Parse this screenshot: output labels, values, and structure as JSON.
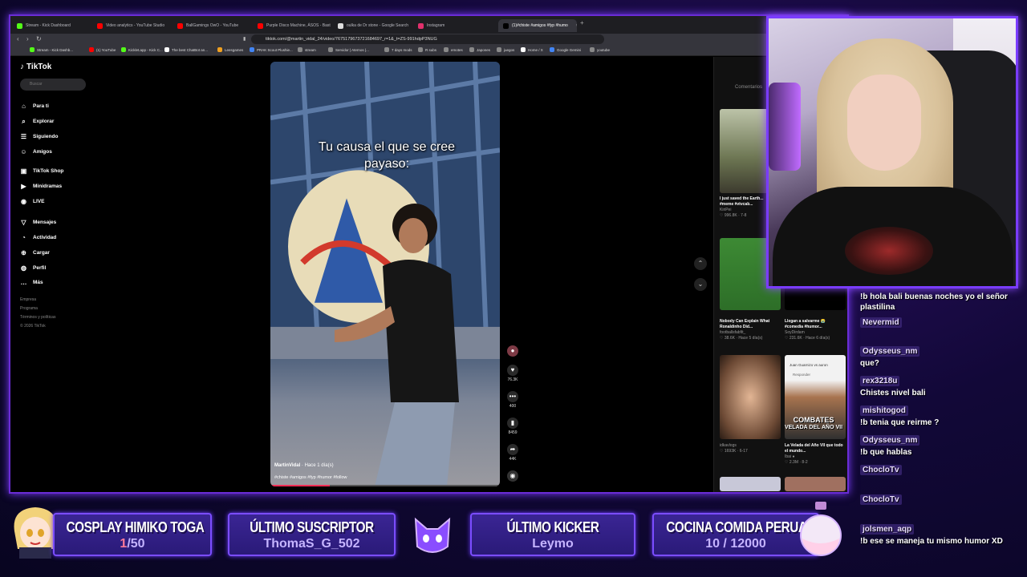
{
  "browser": {
    "tabs": [
      {
        "label": "Stream - Kick Dashboard",
        "color": "#53fc18"
      },
      {
        "label": "Video analytics - YouTube Studio",
        "color": "#ff0000"
      },
      {
        "label": "BallGamings OwO - YouTube",
        "color": "#ff0000"
      },
      {
        "label": "Purple Disco Machine, ÁSOS - Bast",
        "color": "#ff0000"
      },
      {
        "label": "oulka de Dr stone - Google Search",
        "color": "#dddddd"
      },
      {
        "label": "Instagram",
        "color": "#e1306c"
      },
      {
        "label": "(1)#chiste #amigos #fyp #humo",
        "color": "#000000"
      }
    ],
    "url": "tiktok.com/@martin_vidal_24/video/7675179673721684697_r=1&_t=ZS-991hdpP3NUG",
    "bookmarks": [
      "Stream - Kick Dashb...",
      "(1) YouTube",
      "Kicklet.app - Kick C...",
      "The best ChatBot an...",
      "Leesgames",
      "PRAK Scout Plushie...",
      "stream",
      "Servidor | Aternos |...",
      "7 days mods",
      "R subs",
      "emotes",
      "Japones",
      "juegos",
      "Home / X",
      "Google Gemini",
      "youtube"
    ]
  },
  "tiktok": {
    "logo": "TikTok",
    "search_placeholder": "Buscar",
    "nav": [
      "Para ti",
      "Explorar",
      "Siguiendo",
      "Amigos",
      "TikTok Shop",
      "Minidramas",
      "LIVE",
      "Mensajes",
      "Actividad",
      "Cargar",
      "Perfil",
      "Más"
    ],
    "footer": [
      "Empresa",
      "Programa",
      "Términos y políticas",
      "© 2026 TikTok"
    ],
    "video": {
      "caption_line1": "Tu causa el que se cree",
      "caption_line2": "payaso:",
      "author": "MartinVidal",
      "time": " · Hace 1 día(s)",
      "tags": "#chiste #amigos #fyp #humor #follow",
      "progress": 0.26
    },
    "actions": {
      "likes": "76.3K",
      "comments": "400",
      "saves": "8459",
      "shares": "44K"
    },
    "comments_tab": "Comentarios",
    "related": [
      {
        "title": "I just saved the Earth...",
        "tags": "#meme #vtvcab...",
        "author": "KiriPei",
        "meta": "♡ 996.8K · 7-8"
      },
      {
        "title": "Nobody Can Explain What Ronaldinho Did...",
        "tags": "",
        "author": "footballsfabfit_",
        "meta": "♡ 38.6K · Hace 5 día(s)"
      },
      {
        "title": "Llegan a salvarme 😭",
        "tags": "#comedia #humor...",
        "author": "SoyDirdam",
        "meta": "♡ 231.6K · Hace 6 día(s)"
      },
      {
        "title": "",
        "tags": "",
        "author": "idkavlogs",
        "meta": "♡ 1693K · 6-17"
      },
      {
        "title": "La Velada del Año VII que todo el mundo...",
        "tags": "",
        "author": "Ibai ●",
        "meta": "♡ 2.3M · 8-2"
      }
    ],
    "combates_line1": "COMBATES",
    "combates_line2": "VELADA DEL AÑO VII",
    "thumb_overlay_1": "Juan Guarnizo vs auron",
    "thumb_overlay_2": "Responder"
  },
  "chat": [
    {
      "user": "",
      "body": "!b hola bali buenas noches yo el señor plastilina"
    },
    {
      "user": "Nevermid",
      "body": ""
    },
    {
      "user": "Odysseus_nm",
      "body": "que?"
    },
    {
      "user": "rex3218u",
      "body": "Chistes nivel bali"
    },
    {
      "user": "mishitogod",
      "body": "!b tenia que reirme ?"
    },
    {
      "user": "Odysseus_nm",
      "body": "!b que hablas"
    },
    {
      "user": "ChocloTv",
      "body": ""
    },
    {
      "user": "ChocloTv",
      "body": ""
    },
    {
      "user": "jolsmen_aqp",
      "body": "!b ese se maneja tu mismo humor XD"
    }
  ],
  "widgets": {
    "goal1": {
      "title": "COSPLAY HIMIKO TOGA",
      "value_hl": "1",
      "value_rest": "/50"
    },
    "sub": {
      "title": "ÚLTIMO SUSCRIPTOR",
      "value": "ThomaS_G_502"
    },
    "kicker": {
      "title": "ÚLTIMO KICKER",
      "value": "Leymo"
    },
    "goal2": {
      "title": "COCINA COMIDA PERUANA",
      "value": "10 / 12000"
    }
  },
  "colors": {
    "accent": "#7b4dff",
    "tiktok_red": "#fe2c55"
  }
}
